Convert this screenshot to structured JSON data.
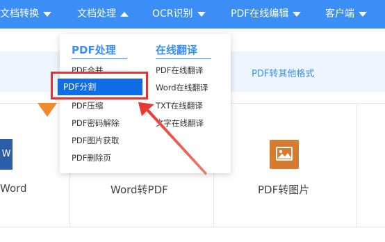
{
  "nav": {
    "items": [
      {
        "label": "文档转换",
        "caret": "down"
      },
      {
        "label": "文档处理",
        "caret": "up"
      },
      {
        "label": "OCR识别",
        "caret": "down"
      },
      {
        "label": "PDF在线编辑",
        "caret": "down"
      },
      {
        "label": "客户端",
        "caret": "down"
      }
    ]
  },
  "band": {
    "right_text": "PDF转其他格式"
  },
  "dropdown": {
    "col1": {
      "heading": "PDF处理",
      "items": [
        "PDF合并",
        "PDF分割",
        "PDF压缩",
        "PDF密码解除",
        "PDF图片获取",
        "PDF删除页"
      ],
      "active_index": 1
    },
    "col2": {
      "heading": "在线翻译",
      "items": [
        "PDF在线翻译",
        "Word在线翻译",
        "TXT在线翻译",
        "文字在线翻译"
      ]
    }
  },
  "cards": [
    {
      "label": "Word",
      "icon": "word-icon",
      "icon_text": "W"
    },
    {
      "label": "Word转PDF",
      "icon": "word-to-pdf-icon"
    },
    {
      "label": "PDF转图片",
      "icon": "image-icon"
    }
  ],
  "colors": {
    "nav_bg": "#3a8ef6",
    "accent": "#3a8ef6",
    "active_item_bg": "#0f6ee6",
    "highlight_red": "#e8322f",
    "band_bg": "#eef5ff"
  }
}
